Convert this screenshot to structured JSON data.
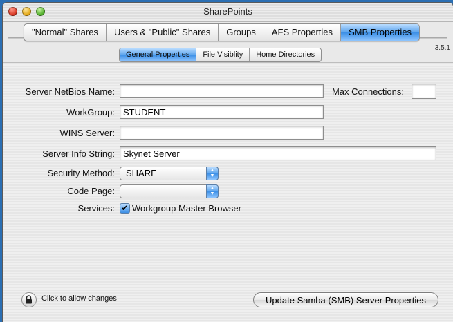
{
  "window": {
    "title": "SharePoints"
  },
  "tabs": [
    {
      "label": "\"Normal\" Shares"
    },
    {
      "label": "Users & \"Public\" Shares"
    },
    {
      "label": "Groups"
    },
    {
      "label": "AFS Properties"
    },
    {
      "label": "SMB Properties"
    }
  ],
  "selected_tab": "SMB Properties",
  "version": "3.5.1",
  "subtabs": [
    {
      "label": "General Properties"
    },
    {
      "label": "File Visiblity"
    },
    {
      "label": "Home Directories"
    }
  ],
  "selected_subtab": "General Properties",
  "form": {
    "netbios_label": "Server NetBios Name:",
    "netbios_value": "",
    "max_connections_label": "Max Connections:",
    "max_connections_value": "",
    "workgroup_label": "WorkGroup:",
    "workgroup_value": "STUDENT",
    "wins_label": "WINS Server:",
    "wins_value": "",
    "info_label": "Server Info String:",
    "info_value": "Skynet Server",
    "security_label": "Security Method:",
    "security_value": "SHARE",
    "codepage_label": "Code Page:",
    "codepage_value": "",
    "services_label": "Services:",
    "services_checkbox_label": "Workgroup Master Browser",
    "services_checked": true
  },
  "footer": {
    "lock_text": "Click to allow changes",
    "update_button": "Update Samba (SMB) Server Properties"
  }
}
